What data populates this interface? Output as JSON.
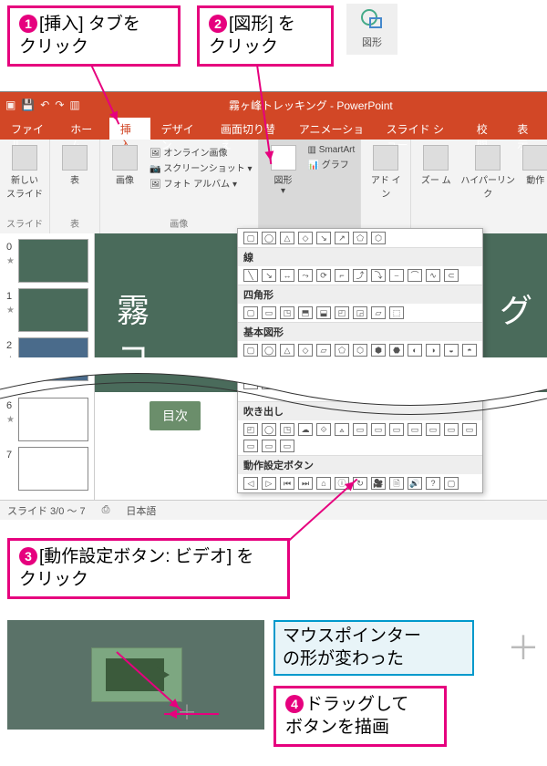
{
  "callouts": {
    "c1": {
      "num": "1",
      "text_a": "[挿入] タブを",
      "text_b": "クリック"
    },
    "c2": {
      "num": "2",
      "text_a": "[図形] を",
      "text_b": "クリック"
    },
    "c3": {
      "num": "3",
      "text_a": "[動作設定ボタン: ビデオ] を",
      "text_b": "クリック"
    },
    "blue": {
      "line1": "マウスポインター",
      "line2": "の形が変わった"
    },
    "c4": {
      "num": "4",
      "text_a": "ドラッグして",
      "text_b": "ボタンを描画"
    }
  },
  "shapes_button": {
    "label": "図形"
  },
  "ppt": {
    "document_title": "霧ヶ峰トレッキング - PowerPoint",
    "tabs": [
      "ファイル",
      "ホーム",
      "挿入",
      "デザイン",
      "画面切り替え",
      "アニメーション",
      "スライド ショー",
      "校閲",
      "表示"
    ],
    "active_tab": "挿入",
    "ribbon": {
      "new_slide": "新しい\nスライド",
      "table": "表",
      "image": "画像",
      "online_image": "オンライン画像",
      "screenshot": "スクリーンショット",
      "photo_album": "フォト アルバム",
      "shapes": "図形",
      "smartart": "SmartArt",
      "chart": "グラフ",
      "addin": "アド\nイン",
      "zoom": "ズー\nム",
      "hyperlink": "ハイパーリンク",
      "action": "動作",
      "grp_slide": "スライド",
      "grp_table": "表",
      "grp_image": "画像"
    },
    "slide_title_partial": "霧　　　　　　　　　グコ",
    "toc_label": "目次",
    "status": {
      "slide": "スライド 3/0 ～ 7",
      "lang": "日本語"
    },
    "thumb_numbers": [
      "0",
      "1",
      "2",
      "6",
      "7"
    ]
  },
  "gallery": {
    "cat_lines": "線",
    "cat_rects": "四角形",
    "cat_basic": "基本図形",
    "cat_callouts": "吹き出し",
    "cat_action": "動作設定ボタン"
  }
}
